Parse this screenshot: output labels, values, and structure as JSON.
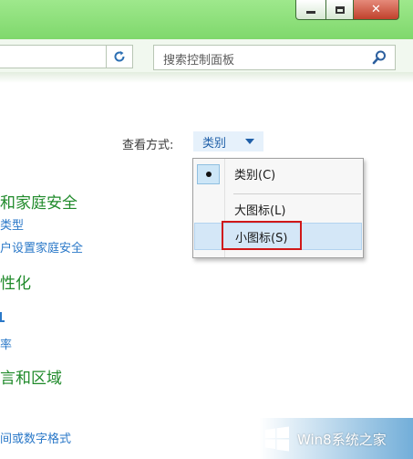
{
  "window": {
    "close_symbol": "✕"
  },
  "toolbar": {
    "search_placeholder": "搜索控制面板"
  },
  "view_by": {
    "label": "查看方式:",
    "value": "类别"
  },
  "left_panel": {
    "section1_title": "和家庭安全",
    "section1_link1": "类型",
    "section1_link2": "户设置家庭安全",
    "section2_title": "性化",
    "section2_link1": "率",
    "section3_title": "言和区域",
    "section3_link1": "间或数字格式"
  },
  "menu": {
    "items": [
      {
        "label": "类别(C)",
        "checked": true
      },
      {
        "label": "大图标(L)",
        "checked": false
      },
      {
        "label": "小图标(S)",
        "checked": false,
        "highlighted": true
      }
    ]
  },
  "watermark": {
    "text": "Win8系统之家"
  },
  "colors": {
    "titlebar": "#8ee07a",
    "link": "#2a78c8",
    "category_title": "#1f8a2a",
    "highlight_border": "#d01818"
  }
}
